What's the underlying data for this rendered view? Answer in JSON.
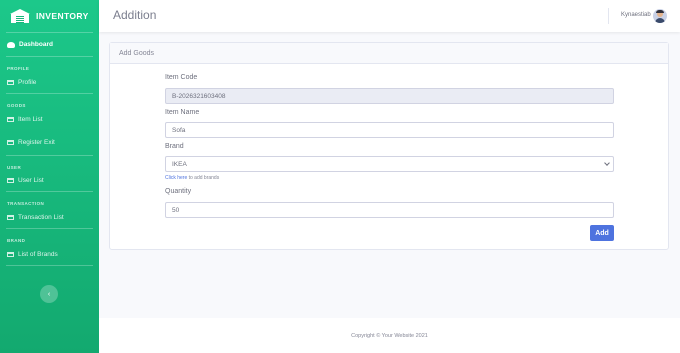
{
  "brand": {
    "name": "INVENTORY",
    "logo_icon": "warehouse-icon"
  },
  "sidebar": {
    "dashboard": {
      "label": "Dashboard",
      "icon": "dashboard-icon"
    },
    "sections": [
      {
        "heading": "PROFILE",
        "items": [
          {
            "label": "Profile",
            "icon": "folder-icon"
          }
        ]
      },
      {
        "heading": "GOODS",
        "items": [
          {
            "label": "Item List",
            "icon": "folder-icon"
          },
          {
            "label": "Register Exit",
            "icon": "folder-icon"
          }
        ]
      },
      {
        "heading": "USER",
        "items": [
          {
            "label": "User List",
            "icon": "folder-icon"
          }
        ]
      },
      {
        "heading": "TRANSACTION",
        "items": [
          {
            "label": "Transaction List",
            "icon": "folder-icon"
          }
        ]
      },
      {
        "heading": "BRAND",
        "items": [
          {
            "label": "List of Brands",
            "icon": "folder-icon"
          }
        ]
      }
    ],
    "toggle_glyph": "‹"
  },
  "topbar": {
    "title": "Addition",
    "username": "Kynaestiab"
  },
  "card": {
    "header": "Add Goods",
    "fields": {
      "item_code": {
        "label": "Item Code",
        "value": "B-2026321603408"
      },
      "item_name": {
        "label": "Item Name",
        "value": "Sofa"
      },
      "brand": {
        "label": "Brand",
        "selected": "IKEA",
        "help_link": "Click here",
        "help_rest": " to add brands"
      },
      "quantity": {
        "label": "Quantity",
        "value": "50"
      }
    },
    "submit_label": "Add"
  },
  "footer": {
    "text": "Copyright © Your Website 2021"
  },
  "colors": {
    "sidebar": "#1cc88a",
    "primary": "#4e73df"
  }
}
